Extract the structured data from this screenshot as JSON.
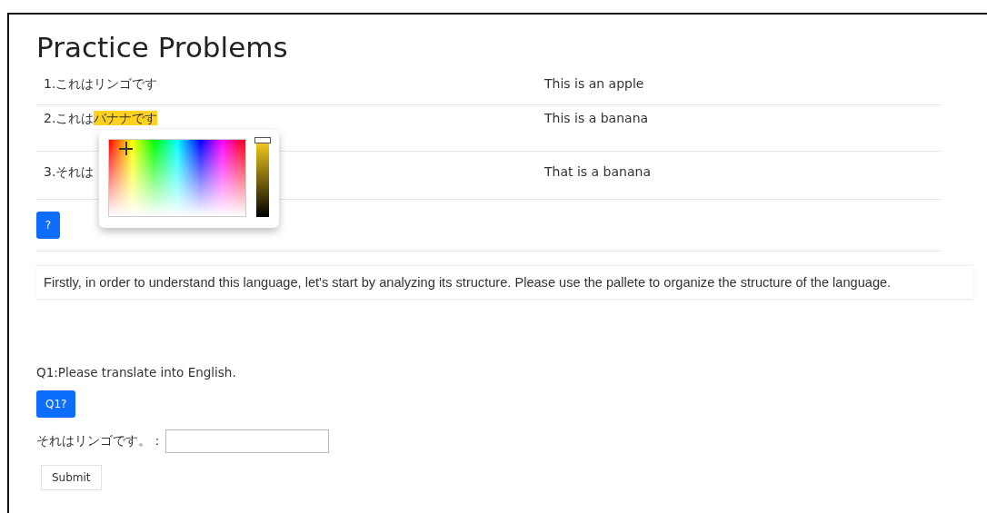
{
  "title": "Practice Problems",
  "rows": [
    {
      "segments": [
        {
          "text": "1.これはリンゴです",
          "highlighted": false
        }
      ],
      "translation": "This is an apple"
    },
    {
      "segments": [
        {
          "text": "2.これは",
          "highlighted": false
        },
        {
          "text": "バナナです",
          "highlighted": true
        }
      ],
      "translation": "This is a banana"
    },
    {
      "segments": [
        {
          "text": "3.それは",
          "highlighted": false
        }
      ],
      "translation": "That is a banana"
    }
  ],
  "help_button": "?",
  "instruction": "Firstly, in order to understand this language, let's start by analyzing its structure. Please use the pallete to organize the structure of the language.",
  "question": {
    "prompt": "Q1:Please translate into English.",
    "hint_button": "Q1?",
    "label": "それはリンゴです。：",
    "submit": "Submit"
  },
  "color_picker": {
    "open": true
  }
}
